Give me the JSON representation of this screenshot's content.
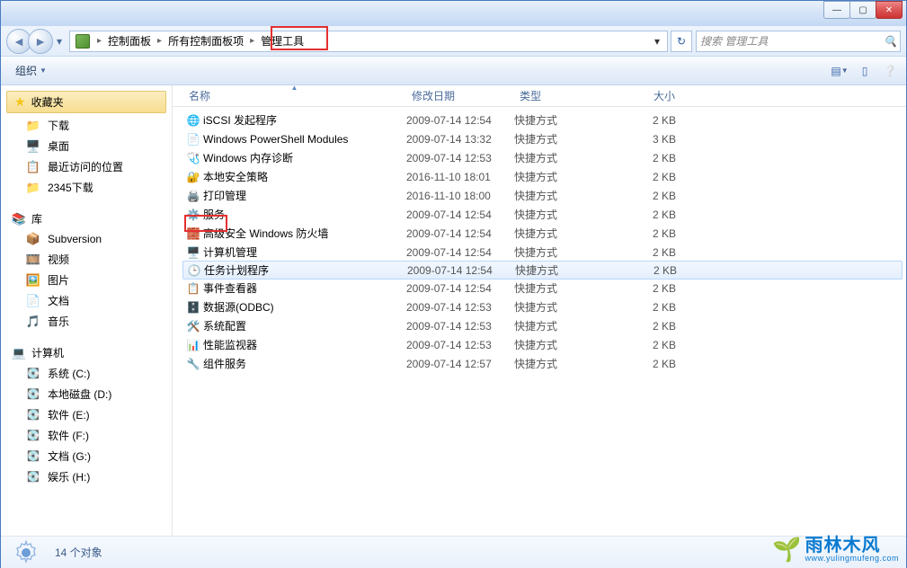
{
  "window": {
    "min": "—",
    "max": "▢",
    "close": "✕"
  },
  "breadcrumb": {
    "items": [
      "控制面板",
      "所有控制面板项",
      "管理工具"
    ]
  },
  "search": {
    "placeholder": "搜索 管理工具"
  },
  "toolbar": {
    "organize": "组织"
  },
  "nav": {
    "favorites": "收藏夹",
    "fav_items": [
      "下载",
      "桌面",
      "最近访问的位置",
      "2345下载"
    ],
    "libraries": "库",
    "lib_items": [
      "Subversion",
      "视频",
      "图片",
      "文档",
      "音乐"
    ],
    "computer": "计算机",
    "drives": [
      "系统 (C:)",
      "本地磁盘 (D:)",
      "软件 (E:)",
      "软件 (F:)",
      "文档 (G:)",
      "娱乐 (H:)"
    ]
  },
  "columns": {
    "name": "名称",
    "date": "修改日期",
    "type": "类型",
    "size": "大小"
  },
  "files": [
    {
      "icon": "🌐",
      "name": "iSCSI 发起程序",
      "date": "2009-07-14 12:54",
      "type": "快捷方式",
      "size": "2 KB"
    },
    {
      "icon": "📄",
      "name": "Windows PowerShell Modules",
      "date": "2009-07-14 13:32",
      "type": "快捷方式",
      "size": "3 KB"
    },
    {
      "icon": "🩺",
      "name": "Windows 内存诊断",
      "date": "2009-07-14 12:53",
      "type": "快捷方式",
      "size": "2 KB"
    },
    {
      "icon": "🔐",
      "name": "本地安全策略",
      "date": "2016-11-10 18:01",
      "type": "快捷方式",
      "size": "2 KB"
    },
    {
      "icon": "🖨️",
      "name": "打印管理",
      "date": "2016-11-10 18:00",
      "type": "快捷方式",
      "size": "2 KB"
    },
    {
      "icon": "⚙️",
      "name": "服务",
      "date": "2009-07-14 12:54",
      "type": "快捷方式",
      "size": "2 KB"
    },
    {
      "icon": "🧱",
      "name": "高级安全 Windows 防火墙",
      "date": "2009-07-14 12:54",
      "type": "快捷方式",
      "size": "2 KB"
    },
    {
      "icon": "🖥️",
      "name": "计算机管理",
      "date": "2009-07-14 12:54",
      "type": "快捷方式",
      "size": "2 KB"
    },
    {
      "icon": "🕒",
      "name": "任务计划程序",
      "date": "2009-07-14 12:54",
      "type": "快捷方式",
      "size": "2 KB",
      "sel": true
    },
    {
      "icon": "📋",
      "name": "事件查看器",
      "date": "2009-07-14 12:54",
      "type": "快捷方式",
      "size": "2 KB"
    },
    {
      "icon": "🗄️",
      "name": "数据源(ODBC)",
      "date": "2009-07-14 12:53",
      "type": "快捷方式",
      "size": "2 KB"
    },
    {
      "icon": "🛠️",
      "name": "系统配置",
      "date": "2009-07-14 12:53",
      "type": "快捷方式",
      "size": "2 KB"
    },
    {
      "icon": "📊",
      "name": "性能监视器",
      "date": "2009-07-14 12:53",
      "type": "快捷方式",
      "size": "2 KB"
    },
    {
      "icon": "🔧",
      "name": "组件服务",
      "date": "2009-07-14 12:57",
      "type": "快捷方式",
      "size": "2 KB"
    }
  ],
  "details": {
    "count": "14 个对象"
  },
  "watermark": {
    "main": "雨林木风",
    "sub": "www.yulingmufeng.com"
  }
}
